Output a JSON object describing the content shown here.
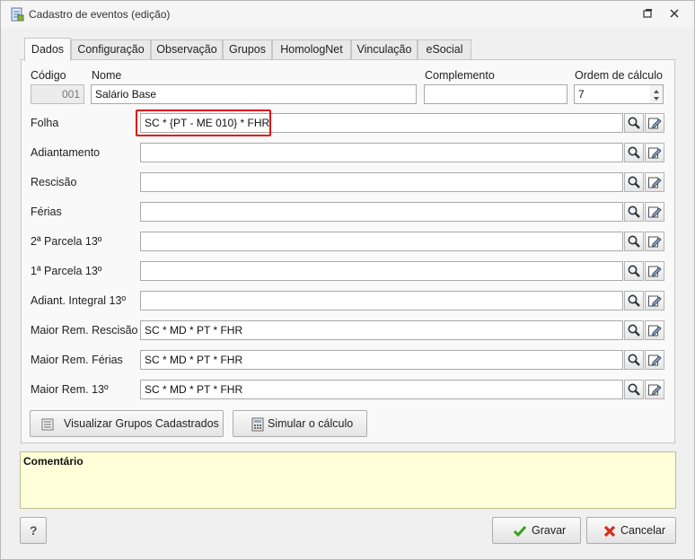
{
  "window": {
    "title": "Cadastro de eventos (edição)",
    "icons": {
      "app": "form-icon",
      "restore": "restore-icon",
      "close": "close-icon"
    }
  },
  "tabs": [
    {
      "label": "Dados",
      "active": true
    },
    {
      "label": "Configuração",
      "active": false
    },
    {
      "label": "Observação",
      "active": false
    },
    {
      "label": "Grupos",
      "active": false
    },
    {
      "label": "HomologNet",
      "active": false
    },
    {
      "label": "Vinculação",
      "active": false
    },
    {
      "label": "eSocial",
      "active": false
    }
  ],
  "header_fields": {
    "codigo": {
      "label": "Código",
      "value": "001"
    },
    "nome": {
      "label": "Nome",
      "value": "Salário Base"
    },
    "complemento": {
      "label": "Complemento",
      "value": ""
    },
    "ordem": {
      "label": "Ordem de cálculo",
      "value": "7"
    }
  },
  "formula_rows": [
    {
      "label": "Folha",
      "value": "SC * {PT - ME 010} * FHR",
      "highlighted": true
    },
    {
      "label": "Adiantamento",
      "value": ""
    },
    {
      "label": "Rescisão",
      "value": ""
    },
    {
      "label": "Férias",
      "value": ""
    },
    {
      "label": "2ª Parcela 13º",
      "value": ""
    },
    {
      "label": "1ª Parcela 13º",
      "value": ""
    },
    {
      "label": "Adiant. Integral 13º",
      "value": ""
    },
    {
      "label": "Maior Rem. Rescisão",
      "value": "SC * MD * PT * FHR"
    },
    {
      "label": "Maior Rem. Férias",
      "value": "SC * MD * PT * FHR"
    },
    {
      "label": "Maior Rem. 13º",
      "value": "SC * MD * PT * FHR"
    }
  ],
  "row_icons": {
    "search": "magnifier-icon",
    "edit": "edit-icon"
  },
  "buttons": {
    "visualizar": "Visualizar Grupos Cadastrados",
    "simular": "Simular o cálculo",
    "help": "?",
    "gravar": "Gravar",
    "cancelar": "Cancelar"
  },
  "comment": {
    "title": "Comentário",
    "value": ""
  },
  "colors": {
    "highlight": "#e01010",
    "comment_bg": "#ffffd9",
    "accept": "#3aa020",
    "cancel": "#d03020"
  }
}
